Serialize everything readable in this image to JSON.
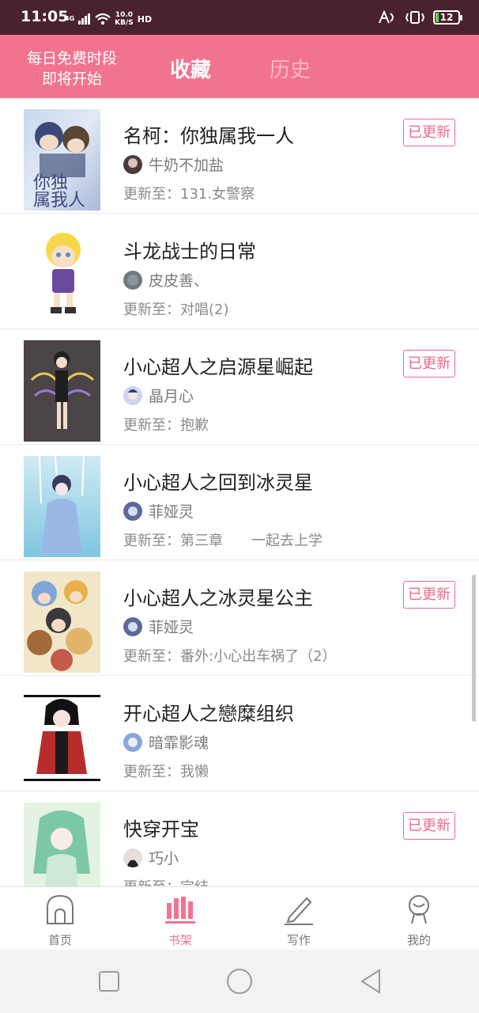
{
  "status_bar": {
    "time": "11:05",
    "signal": "4G",
    "speed_value": "10.0",
    "speed_unit": "KB/S",
    "hd": "HD",
    "battery": "12"
  },
  "header": {
    "promo_line1": "每日免费时段",
    "promo_line2": "即将开始",
    "tab_favorites": "收藏",
    "tab_history": "历史"
  },
  "badge_label": "已更新",
  "books": [
    {
      "title": "名柯：你独属我一人",
      "author": "牛奶不加盐",
      "update": "更新至：131.女警察",
      "updated": true
    },
    {
      "title": "斗龙战士的日常",
      "author": "皮皮善、",
      "update": "更新至：对唱(2)",
      "updated": false
    },
    {
      "title": "小心超人之启源星崛起",
      "author": "晶月心",
      "update": "更新至：抱歉",
      "updated": true
    },
    {
      "title": "小心超人之回到冰灵星",
      "author": "菲娅灵",
      "update": "更新至：第三章　　一起去上学",
      "updated": false
    },
    {
      "title": "小心超人之冰灵星公主",
      "author": "菲娅灵",
      "update": "更新至：番外:小心出车祸了（2）",
      "updated": true
    },
    {
      "title": "开心超人之戀糜组织",
      "author": "暗霏影魂",
      "update": "更新至：我懒",
      "updated": false
    },
    {
      "title": "快穿开宝",
      "author": "巧小",
      "update": "更新至：完结",
      "updated": true
    }
  ],
  "bottom_nav": {
    "home": "首页",
    "bookshelf": "书架",
    "write": "写作",
    "mine": "我的"
  },
  "colors": {
    "accent": "#f2738f",
    "status_bar": "#4a222d",
    "badge": "#f06b8a"
  }
}
